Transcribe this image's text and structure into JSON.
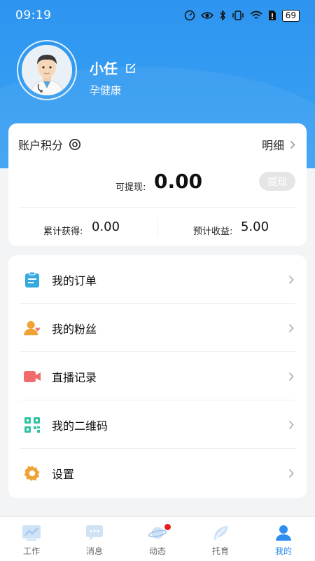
{
  "status_bar": {
    "time": "09:19",
    "battery": "69"
  },
  "profile": {
    "name": "小任",
    "subtitle": "孕健康"
  },
  "points_card": {
    "title": "账户积分",
    "detail_label": "明细",
    "withdrawable_label": "可提现:",
    "withdrawable_value": "0.00",
    "withdraw_button": "提现",
    "total_earned_label": "累计获得:",
    "total_earned_value": "0.00",
    "expected_income_label": "预计收益:",
    "expected_income_value": "5.00"
  },
  "menu": {
    "items": [
      {
        "label": "我的订单",
        "icon": "clipboard-icon"
      },
      {
        "label": "我的粉丝",
        "icon": "fans-icon"
      },
      {
        "label": "直播记录",
        "icon": "video-icon"
      },
      {
        "label": "我的二维码",
        "icon": "qr-code-icon"
      },
      {
        "label": "设置",
        "icon": "gear-icon"
      }
    ]
  },
  "bottom_nav": {
    "items": [
      {
        "label": "工作",
        "icon": "chart-icon"
      },
      {
        "label": "消息",
        "icon": "chat-icon"
      },
      {
        "label": "动态",
        "icon": "planet-icon"
      },
      {
        "label": "托育",
        "icon": "leaf-icon"
      },
      {
        "label": "我的",
        "icon": "user-icon"
      }
    ],
    "active": "我的"
  },
  "colors": {
    "header_blue": "#2d95f0",
    "accent_blue": "#2d8ef0",
    "notification_red": "#e91b1b",
    "order_icon": "#35a9e0",
    "fans_icon": "#f0a234",
    "live_icon": "#f26b6b",
    "qr_icon": "#2ec3a3",
    "settings_icon": "#f0a234"
  }
}
